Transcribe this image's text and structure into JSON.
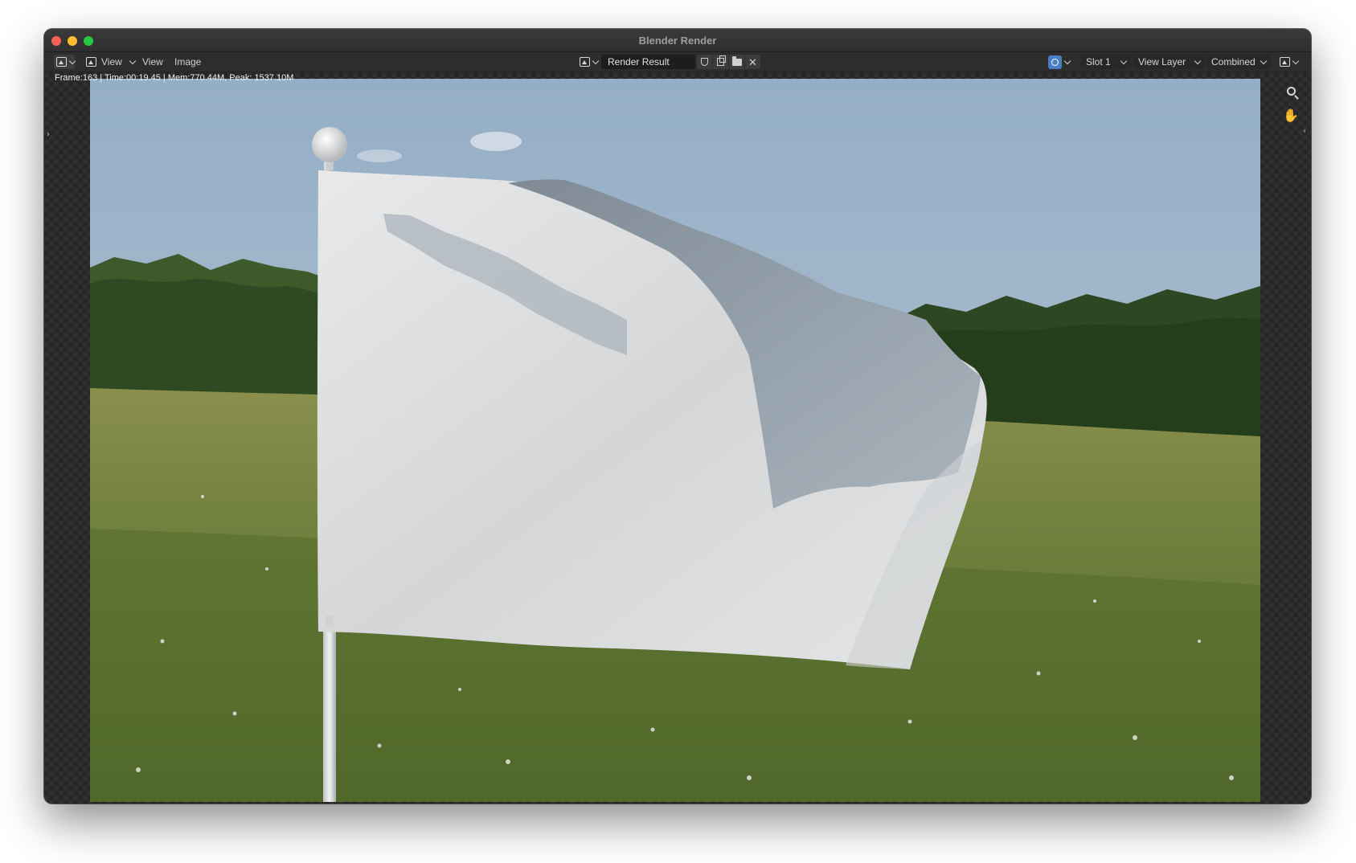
{
  "window": {
    "title": "Blender Render"
  },
  "header": {
    "editor_type_icon": "image-editor-icon",
    "menus": [
      "View",
      "View",
      "Image"
    ],
    "image_name": "Render Result",
    "slot": "Slot 1",
    "view_layer": "View Layer",
    "render_pass": "Combined"
  },
  "status": {
    "text": "Frame:163 | Time:00:19.45 | Mem:770.44M, Peak: 1537.10M"
  },
  "tools": [
    "zoom-icon",
    "hand-icon"
  ],
  "colors": {
    "overlay_active": "#4a7ec7",
    "traffic_close": "#ff5f57",
    "traffic_min": "#febc2e",
    "traffic_max": "#28c840"
  }
}
